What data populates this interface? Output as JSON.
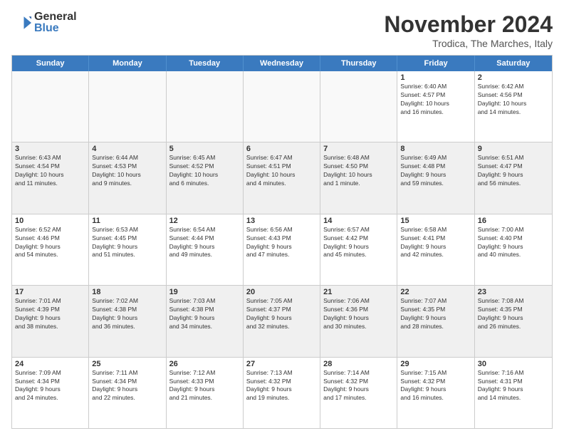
{
  "logo": {
    "general": "General",
    "blue": "Blue"
  },
  "header": {
    "month": "November 2024",
    "location": "Trodica, The Marches, Italy"
  },
  "weekdays": [
    "Sunday",
    "Monday",
    "Tuesday",
    "Wednesday",
    "Thursday",
    "Friday",
    "Saturday"
  ],
  "rows": [
    [
      {
        "day": "",
        "info": "",
        "empty": true
      },
      {
        "day": "",
        "info": "",
        "empty": true
      },
      {
        "day": "",
        "info": "",
        "empty": true
      },
      {
        "day": "",
        "info": "",
        "empty": true
      },
      {
        "day": "",
        "info": "",
        "empty": true
      },
      {
        "day": "1",
        "info": "Sunrise: 6:40 AM\nSunset: 4:57 PM\nDaylight: 10 hours\nand 16 minutes."
      },
      {
        "day": "2",
        "info": "Sunrise: 6:42 AM\nSunset: 4:56 PM\nDaylight: 10 hours\nand 14 minutes."
      }
    ],
    [
      {
        "day": "3",
        "info": "Sunrise: 6:43 AM\nSunset: 4:54 PM\nDaylight: 10 hours\nand 11 minutes."
      },
      {
        "day": "4",
        "info": "Sunrise: 6:44 AM\nSunset: 4:53 PM\nDaylight: 10 hours\nand 9 minutes."
      },
      {
        "day": "5",
        "info": "Sunrise: 6:45 AM\nSunset: 4:52 PM\nDaylight: 10 hours\nand 6 minutes."
      },
      {
        "day": "6",
        "info": "Sunrise: 6:47 AM\nSunset: 4:51 PM\nDaylight: 10 hours\nand 4 minutes."
      },
      {
        "day": "7",
        "info": "Sunrise: 6:48 AM\nSunset: 4:50 PM\nDaylight: 10 hours\nand 1 minute."
      },
      {
        "day": "8",
        "info": "Sunrise: 6:49 AM\nSunset: 4:48 PM\nDaylight: 9 hours\nand 59 minutes."
      },
      {
        "day": "9",
        "info": "Sunrise: 6:51 AM\nSunset: 4:47 PM\nDaylight: 9 hours\nand 56 minutes."
      }
    ],
    [
      {
        "day": "10",
        "info": "Sunrise: 6:52 AM\nSunset: 4:46 PM\nDaylight: 9 hours\nand 54 minutes."
      },
      {
        "day": "11",
        "info": "Sunrise: 6:53 AM\nSunset: 4:45 PM\nDaylight: 9 hours\nand 51 minutes."
      },
      {
        "day": "12",
        "info": "Sunrise: 6:54 AM\nSunset: 4:44 PM\nDaylight: 9 hours\nand 49 minutes."
      },
      {
        "day": "13",
        "info": "Sunrise: 6:56 AM\nSunset: 4:43 PM\nDaylight: 9 hours\nand 47 minutes."
      },
      {
        "day": "14",
        "info": "Sunrise: 6:57 AM\nSunset: 4:42 PM\nDaylight: 9 hours\nand 45 minutes."
      },
      {
        "day": "15",
        "info": "Sunrise: 6:58 AM\nSunset: 4:41 PM\nDaylight: 9 hours\nand 42 minutes."
      },
      {
        "day": "16",
        "info": "Sunrise: 7:00 AM\nSunset: 4:40 PM\nDaylight: 9 hours\nand 40 minutes."
      }
    ],
    [
      {
        "day": "17",
        "info": "Sunrise: 7:01 AM\nSunset: 4:39 PM\nDaylight: 9 hours\nand 38 minutes."
      },
      {
        "day": "18",
        "info": "Sunrise: 7:02 AM\nSunset: 4:38 PM\nDaylight: 9 hours\nand 36 minutes."
      },
      {
        "day": "19",
        "info": "Sunrise: 7:03 AM\nSunset: 4:38 PM\nDaylight: 9 hours\nand 34 minutes."
      },
      {
        "day": "20",
        "info": "Sunrise: 7:05 AM\nSunset: 4:37 PM\nDaylight: 9 hours\nand 32 minutes."
      },
      {
        "day": "21",
        "info": "Sunrise: 7:06 AM\nSunset: 4:36 PM\nDaylight: 9 hours\nand 30 minutes."
      },
      {
        "day": "22",
        "info": "Sunrise: 7:07 AM\nSunset: 4:35 PM\nDaylight: 9 hours\nand 28 minutes."
      },
      {
        "day": "23",
        "info": "Sunrise: 7:08 AM\nSunset: 4:35 PM\nDaylight: 9 hours\nand 26 minutes."
      }
    ],
    [
      {
        "day": "24",
        "info": "Sunrise: 7:09 AM\nSunset: 4:34 PM\nDaylight: 9 hours\nand 24 minutes."
      },
      {
        "day": "25",
        "info": "Sunrise: 7:11 AM\nSunset: 4:34 PM\nDaylight: 9 hours\nand 22 minutes."
      },
      {
        "day": "26",
        "info": "Sunrise: 7:12 AM\nSunset: 4:33 PM\nDaylight: 9 hours\nand 21 minutes."
      },
      {
        "day": "27",
        "info": "Sunrise: 7:13 AM\nSunset: 4:32 PM\nDaylight: 9 hours\nand 19 minutes."
      },
      {
        "day": "28",
        "info": "Sunrise: 7:14 AM\nSunset: 4:32 PM\nDaylight: 9 hours\nand 17 minutes."
      },
      {
        "day": "29",
        "info": "Sunrise: 7:15 AM\nSunset: 4:32 PM\nDaylight: 9 hours\nand 16 minutes."
      },
      {
        "day": "30",
        "info": "Sunrise: 7:16 AM\nSunset: 4:31 PM\nDaylight: 9 hours\nand 14 minutes."
      }
    ]
  ]
}
